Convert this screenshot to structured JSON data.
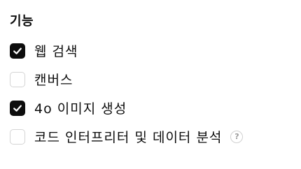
{
  "section": {
    "title": "기능",
    "options": [
      {
        "label": "웹 검색",
        "checked": true
      },
      {
        "label": "캔버스",
        "checked": false
      },
      {
        "label": "4o 이미지 생성",
        "checked": true
      },
      {
        "label": "코드 인터프리터 및 데이터 분석",
        "checked": false,
        "help": "?"
      }
    ]
  },
  "colors": {
    "checked_fill": "#0d0d0d",
    "unchecked_border": "#d4d4d4",
    "text": "#0d0d0d"
  },
  "icons": {
    "checked": "checkmark-icon",
    "help": "question-circle-icon"
  }
}
